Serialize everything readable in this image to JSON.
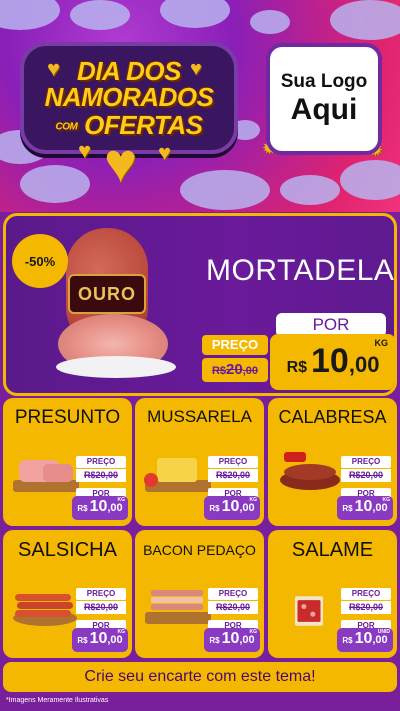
{
  "header": {
    "banner_line1": "DIA DOS",
    "banner_line2": "NAMORADOS",
    "banner_line3_small": "COM",
    "banner_line3": "OFERTAS",
    "logo_line1": "Sua Logo",
    "logo_line2": "Aqui"
  },
  "featured": {
    "discount": "-50%",
    "brand_label": "OURO",
    "name": "MORTADELA",
    "preco_label": "PREÇO",
    "old_price_currency": "R$",
    "old_price_int": "20",
    "old_price_dec": ",00",
    "por_label": "POR",
    "new_price_currency": "R$",
    "new_price_int": "10",
    "new_price_dec": ",00",
    "unit": "KG"
  },
  "products": [
    {
      "name": "PRESUNTO",
      "preco_label": "PREÇO",
      "old": "R$20,00",
      "por_label": "POR",
      "currency": "R$",
      "int": "10",
      "dec": ",00",
      "unit": "KG"
    },
    {
      "name": "MUSSARELA",
      "preco_label": "PREÇO",
      "old": "R$20,00",
      "por_label": "POR",
      "currency": "R$",
      "int": "10",
      "dec": ",00",
      "unit": "KG"
    },
    {
      "name": "CALABRESA",
      "preco_label": "PREÇO",
      "old": "R$20,00",
      "por_label": "POR",
      "currency": "R$",
      "int": "10",
      "dec": ",00",
      "unit": "KG"
    },
    {
      "name": "SALSICHA",
      "preco_label": "PREÇO",
      "old": "R$20,00",
      "por_label": "POR",
      "currency": "R$",
      "int": "10",
      "dec": ",00",
      "unit": "KG"
    },
    {
      "name": "BACON PEDAÇO",
      "preco_label": "PREÇO",
      "old": "R$20,00",
      "por_label": "POR",
      "currency": "R$",
      "int": "10",
      "dec": ",00",
      "unit": "KG"
    },
    {
      "name": "SALAME",
      "preco_label": "PREÇO",
      "old": "R$20,00",
      "por_label": "POR",
      "currency": "R$",
      "int": "10",
      "dec": ",00",
      "unit": "UNID"
    }
  ],
  "cta": "Crie seu encarte com este tema!",
  "disclaimer": "*Imagens Meramente Ilustrativas",
  "colors": {
    "purple": "#6a1a9a",
    "yellow": "#f5b800",
    "pink": "#e0236e"
  },
  "icons": [
    "heart-icon",
    "sun-icon"
  ]
}
